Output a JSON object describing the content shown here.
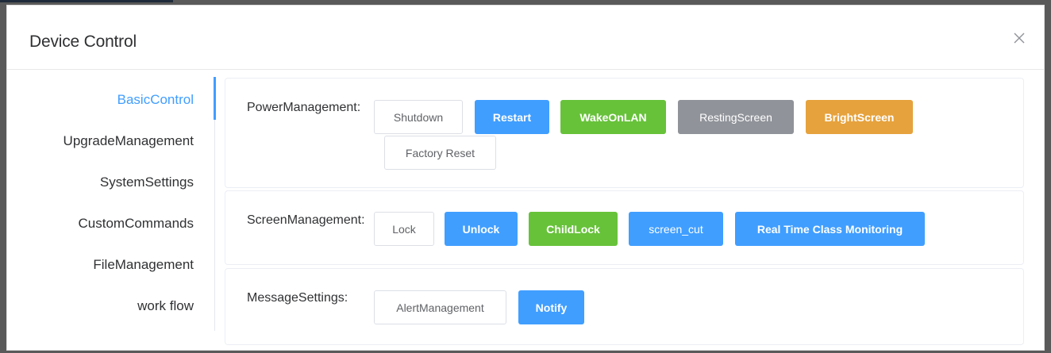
{
  "dialog": {
    "title": "Device Control",
    "close_icon": "close-icon"
  },
  "sidebar": {
    "items": [
      {
        "label": "BasicControl",
        "active": true
      },
      {
        "label": "UpgradeManagement",
        "active": false
      },
      {
        "label": "SystemSettings",
        "active": false
      },
      {
        "label": "CustomCommands",
        "active": false
      },
      {
        "label": "FileManagement",
        "active": false
      },
      {
        "label": "work flow",
        "active": false
      }
    ]
  },
  "sections": {
    "power": {
      "label": "PowerManagement:",
      "buttons": {
        "shutdown": "Shutdown",
        "restart": "Restart",
        "wake_on_lan": "WakeOnLAN",
        "resting_screen": "RestingScreen",
        "bright_screen": "BrightScreen",
        "factory_reset": "Factory Reset"
      }
    },
    "screen": {
      "label": "ScreenManagement:",
      "buttons": {
        "lock": "Lock",
        "unlock": "Unlock",
        "child_lock": "ChildLock",
        "screen_cut": "screen_cut",
        "real_time_monitoring": "Real Time Class Monitoring"
      }
    },
    "message": {
      "label": "MessageSettings:",
      "buttons": {
        "alert_management": "AlertManagement",
        "notify": "Notify"
      }
    }
  },
  "colors": {
    "primary": "#409eff",
    "success": "#67c23a",
    "info": "#909399",
    "warning": "#e6a23c"
  }
}
